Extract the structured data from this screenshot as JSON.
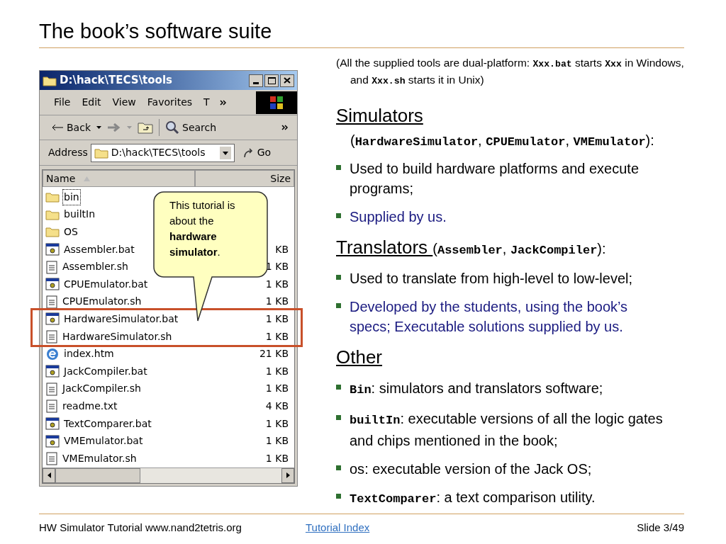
{
  "title": "The book’s software suite",
  "explorer": {
    "title": "D:\\hack\\TECS\\tools",
    "menu": [
      "File",
      "Edit",
      "View",
      "Favorites",
      "T"
    ],
    "toolbar": {
      "back": "Back",
      "search": "Search"
    },
    "address": {
      "label": "Address",
      "value": "D:\\hack\\TECS\\tools",
      "go": "Go"
    },
    "columns": [
      "Name",
      "Size"
    ],
    "rows": [
      {
        "name": "bin",
        "kind": "folder",
        "focused": true,
        "highlighted": false
      },
      {
        "name": "builtIn",
        "kind": "folder",
        "focused": false,
        "highlighted": false
      },
      {
        "name": "OS",
        "kind": "folder",
        "focused": false,
        "highlighted": false
      },
      {
        "name": "Assembler.bat",
        "size": "KB",
        "kind": "bat",
        "focused": false,
        "highlighted": false
      },
      {
        "name": "Assembler.sh",
        "size": "1 KB",
        "kind": "sh",
        "focused": false,
        "highlighted": false
      },
      {
        "name": "CPUEmulator.bat",
        "size": "1 KB",
        "kind": "bat",
        "focused": false,
        "highlighted": false
      },
      {
        "name": "CPUEmulator.sh",
        "size": "1 KB",
        "kind": "sh",
        "focused": false,
        "highlighted": false
      },
      {
        "name": "HardwareSimulator.bat",
        "size": "1 KB",
        "kind": "bat",
        "focused": false,
        "highlighted": true
      },
      {
        "name": "HardwareSimulator.sh",
        "size": "1 KB",
        "kind": "sh",
        "focused": false,
        "highlighted": true
      },
      {
        "name": "index.htm",
        "size": "21 KB",
        "kind": "htm",
        "focused": false,
        "highlighted": false
      },
      {
        "name": "JackCompiler.bat",
        "size": "1 KB",
        "kind": "bat",
        "focused": false,
        "highlighted": false
      },
      {
        "name": "JackCompiler.sh",
        "size": "1 KB",
        "kind": "sh",
        "focused": false,
        "highlighted": false
      },
      {
        "name": "readme.txt",
        "size": "4 KB",
        "kind": "sh",
        "focused": false,
        "highlighted": false
      },
      {
        "name": "TextComparer.bat",
        "size": "1 KB",
        "kind": "bat",
        "focused": false,
        "highlighted": false
      },
      {
        "name": "VMEmulator.bat",
        "size": "1 KB",
        "kind": "bat",
        "focused": false,
        "highlighted": false
      },
      {
        "name": "VMEmulator.sh",
        "size": "1 KB",
        "kind": "sh",
        "focused": false,
        "highlighted": false
      }
    ]
  },
  "callout": "This tutorial is about the **hardware simulator**.",
  "note": [
    {
      "text": "(All the supplied tools are dual-platform: ",
      "code": false
    },
    {
      "text": "Xxx.bat",
      "code": true
    },
    {
      "text": " starts ",
      "code": false
    },
    {
      "text": "Xxx",
      "code": true
    },
    {
      "text": " in Windows, and ",
      "code": false
    },
    {
      "text": "Xxx.sh",
      "code": true
    },
    {
      "text": " starts it in Unix)",
      "code": false
    }
  ],
  "sections": [
    {
      "heading": "Simulators",
      "kind": "block",
      "detail": [
        {
          "text": "(",
          "code": false
        },
        {
          "text": "HardwareSimulator",
          "code": true
        },
        {
          "text": ", ",
          "code": false
        },
        {
          "text": "CPUEmulator",
          "code": true
        },
        {
          "text": ", ",
          "code": false
        },
        {
          "text": "VMEmulator",
          "code": true
        },
        {
          "text": "):",
          "code": false
        }
      ],
      "bullets": [
        {
          "color": "#000000",
          "parts": [
            {
              "text": "Used to build hardware platforms and execute programs;",
              "code": false
            }
          ]
        },
        {
          "color": "#1a1a80",
          "parts": [
            {
              "text": "Supplied by us.",
              "code": false
            }
          ]
        }
      ]
    },
    {
      "heading": "Translators ",
      "kind": "inline",
      "detail": [
        {
          "text": "(",
          "code": false
        },
        {
          "text": "Assembler",
          "code": true
        },
        {
          "text": ", ",
          "code": false
        },
        {
          "text": "JackCompiler",
          "code": true
        },
        {
          "text": "):",
          "code": false
        }
      ],
      "bullets": [
        {
          "color": "#000000",
          "parts": [
            {
              "text": "Used to translate from high-level to low-level;",
              "code": false
            }
          ]
        },
        {
          "color": "#1a1a80",
          "parts": [
            {
              "text": "Developed by the students, using the book’s specs; Executable solutions supplied by us.",
              "code": false
            }
          ]
        }
      ]
    },
    {
      "heading": "Other",
      "kind": "none",
      "bullets": [
        {
          "color": "#000000",
          "parts": [
            {
              "text": "Bin",
              "code": true
            },
            {
              "text": ": simulators and translators software;",
              "code": false
            }
          ]
        },
        {
          "color": "#000000",
          "parts": [
            {
              "text": "builtIn",
              "code": true
            },
            {
              "text": ": executable versions of all the logic gates and chips mentioned in the book;",
              "code": false
            }
          ]
        },
        {
          "color": "#000000",
          "parts": [
            {
              "text": "os",
              "code": false
            },
            {
              "text": ": executable version of the Jack OS;",
              "code": false
            }
          ]
        },
        {
          "color": "#000000",
          "parts": [
            {
              "text": "TextComparer",
              "code": true
            },
            {
              "text": ": a text comparison utility.",
              "code": false
            }
          ]
        }
      ]
    }
  ],
  "footer": {
    "left": "HW Simulator Tutorial www.nand2tetris.org",
    "link": "Tutorial Index",
    "page": "Slide 3/49"
  }
}
